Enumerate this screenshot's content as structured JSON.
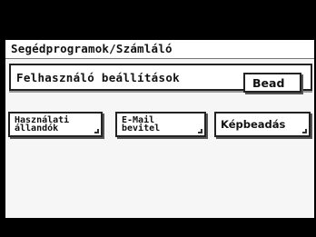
{
  "title": "Segédprogramok/Számláló",
  "subheader": {
    "label": "Felhasználó beállítások",
    "action_button": "Bead"
  },
  "buttons": [
    {
      "label": "Használati\nállandók"
    },
    {
      "label": "E-Mail\nbevitel"
    },
    {
      "label": "Képbeadás"
    }
  ],
  "colors": {
    "background": "#f6f6f6",
    "frame": "#000000",
    "border": "#222222"
  }
}
